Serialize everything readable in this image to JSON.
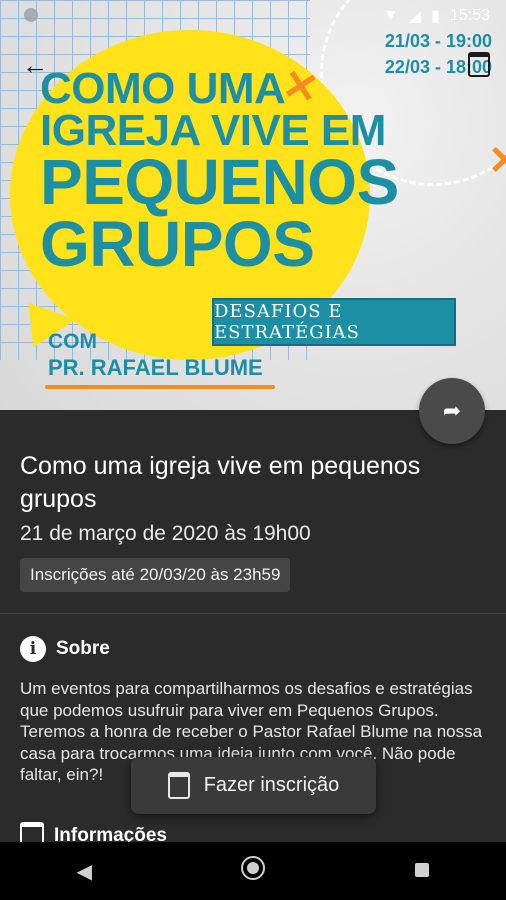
{
  "status_bar": {
    "time": "15:53",
    "icons": [
      "wifi-icon",
      "signal-icon",
      "battery-icon"
    ]
  },
  "hero": {
    "title_lines": [
      "COMO UMA",
      "IGREJA VIVE EM",
      "PEQUENOS",
      "GRUPOS"
    ],
    "subtitle": "DESAFIOS E ESTRATÉGIAS",
    "with_label": "COM",
    "pastor": "PR. RAFAEL BLUME",
    "dates": [
      "21/03 - 19:00",
      "22/03 - 18:00"
    ],
    "colors": {
      "teal": "#1d8fa4",
      "yellow": "#ffe21a",
      "orange": "#f58c1f"
    }
  },
  "event": {
    "title": "Como uma igreja vive em pequenos grupos",
    "date": "21 de março de 2020 às 19h00",
    "registration": "Inscrições até 20/03/20 às 23h59"
  },
  "about": {
    "title": "Sobre",
    "text": "Um eventos para compartilharmos os desafios e estratégias que podemos usufruir para viver em Pequenos Grupos. Teremos a honra de receber o Pastor Rafael Blume na nossa casa para trocarmos uma ideia junto com você. Não pode faltar, ein?!"
  },
  "info": {
    "title": "Informações"
  },
  "cta": {
    "label": "Fazer inscrição"
  },
  "nav": {
    "back": "◀",
    "home": "home",
    "recents": "recents"
  }
}
